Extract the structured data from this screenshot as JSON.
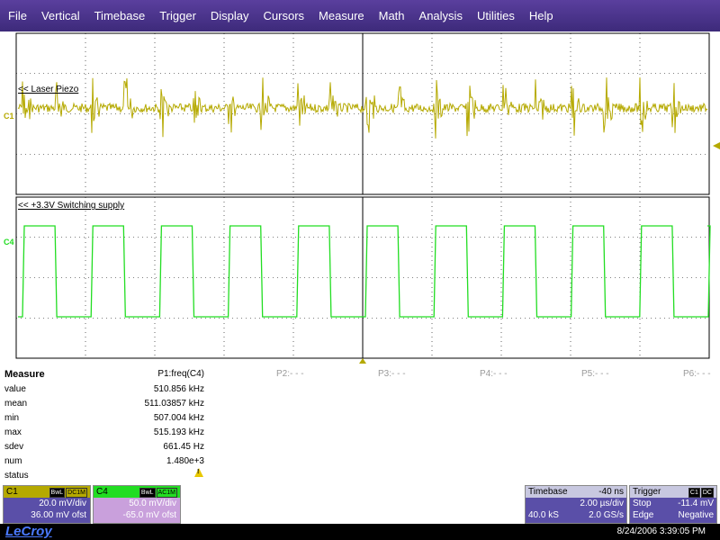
{
  "menu": [
    "File",
    "Vertical",
    "Timebase",
    "Trigger",
    "Display",
    "Cursors",
    "Measure",
    "Math",
    "Analysis",
    "Utilities",
    "Help"
  ],
  "traces": {
    "c1": {
      "label": "<< Laser Piezo",
      "marker": "C1",
      "color": "#b5a900"
    },
    "c4": {
      "label": "<< +3.3V Switching supply",
      "marker": "C4",
      "color": "#22dd22"
    }
  },
  "measure": {
    "title": "Measure",
    "rows": [
      "value",
      "mean",
      "min",
      "max",
      "sdev",
      "num",
      "status"
    ],
    "p1": {
      "header": "P1:freq(C4)",
      "value": "510.856 kHz",
      "mean": "511.03857 kHz",
      "min": "507.004 kHz",
      "max": "515.193 kHz",
      "sdev": "661.45 Hz",
      "num": "1.480e+3",
      "status_icon": "warning-icon"
    },
    "others": [
      "P2:- - -",
      "P3:- - -",
      "P4:- - -",
      "P5:- - -",
      "P6:- - -"
    ]
  },
  "c1_desc": {
    "name": "C1",
    "badge1": "BwL",
    "badge2": "DC1M",
    "vdiv": "20.0 mV/div",
    "offset": "36.00 mV ofst",
    "color": "#b5a900"
  },
  "c4_desc": {
    "name": "C4",
    "badge1": "BwL",
    "badge2": "AC1M",
    "vdiv": "50.0 mV/div",
    "offset": "-65.0 mV ofst",
    "color": "#22dd22"
  },
  "timebase": {
    "title": "Timebase",
    "delay": "-40 ns",
    "tdiv": "2.00 µs/div",
    "samples": "40.0 kS",
    "rate": "2.0 GS/s"
  },
  "trigger": {
    "title": "Trigger",
    "badge1": "C1",
    "badge2": "DC",
    "mode": "Stop",
    "level": "-11.4 mV",
    "type": "Edge",
    "slope": "Negative"
  },
  "footer": {
    "logo": "LeCroy",
    "datetime": "8/24/2006 3:39:05 PM"
  },
  "colors": {
    "menu_bg": "#4b3590",
    "c1": "#b5a900",
    "c4": "#22dd22",
    "grid": "#000000"
  }
}
